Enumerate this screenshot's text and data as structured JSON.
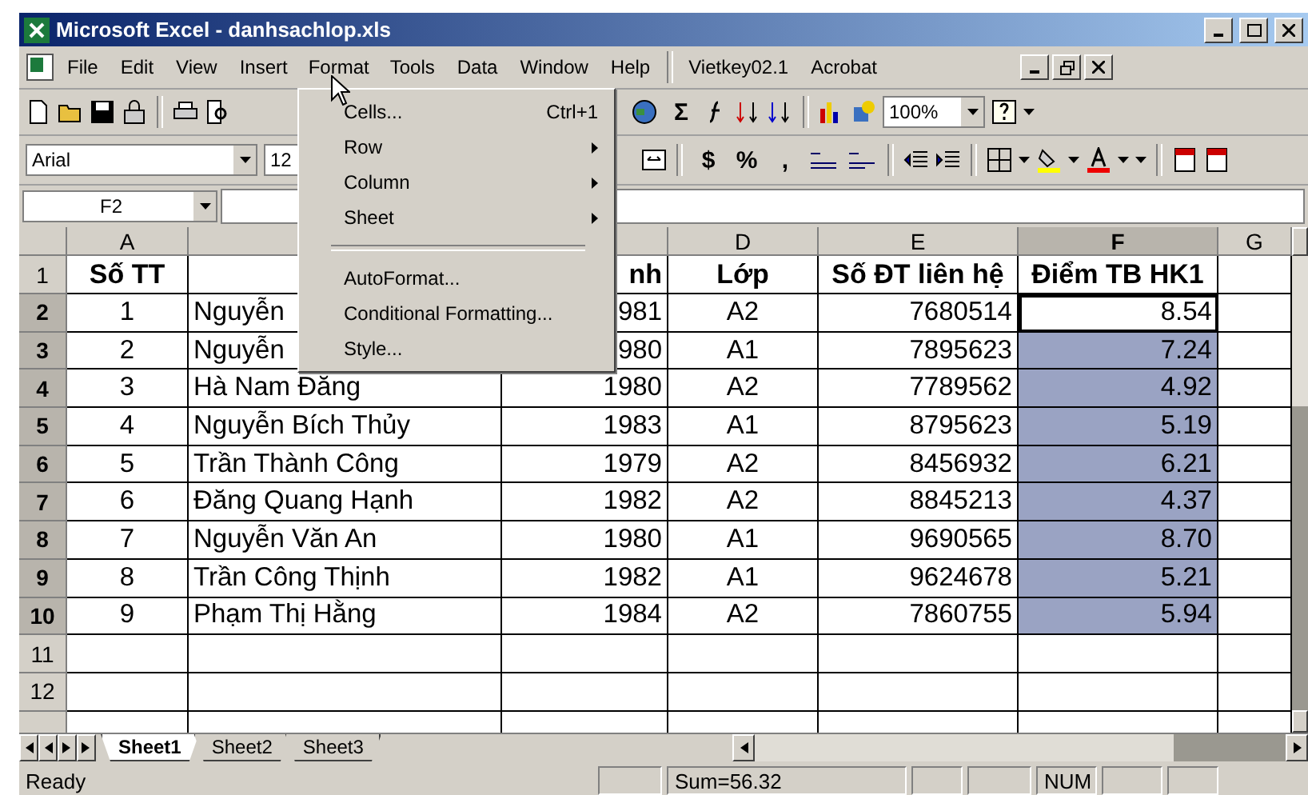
{
  "window": {
    "title": "Microsoft Excel - danhsachlop.xls"
  },
  "menu": [
    {
      "label": "File",
      "selected": false
    },
    {
      "label": "Edit",
      "selected": false
    },
    {
      "label": "View",
      "selected": false
    },
    {
      "label": "Insert",
      "selected": false
    },
    {
      "label": "Format",
      "selected": true
    },
    {
      "label": "Tools",
      "selected": false
    },
    {
      "label": "Data",
      "selected": false
    },
    {
      "label": "Window",
      "selected": false
    },
    {
      "label": "Help",
      "selected": false
    },
    {
      "label": "Vietkey02.1",
      "selected": false
    },
    {
      "label": "Acrobat",
      "selected": false
    }
  ],
  "toolbar": {
    "sum": "Σ",
    "zoom": "100%",
    "font": "Arial",
    "font_size": "12",
    "currency": "$",
    "percent": "%",
    "comma": ","
  },
  "format_menu": [
    {
      "kind": "item",
      "label": "Cells...",
      "shortcut": "Ctrl+1"
    },
    {
      "kind": "submenu",
      "label": "Row"
    },
    {
      "kind": "submenu",
      "label": "Column"
    },
    {
      "kind": "submenu",
      "label": "Sheet"
    },
    {
      "kind": "separator"
    },
    {
      "kind": "item",
      "label": "AutoFormat..."
    },
    {
      "kind": "item",
      "label": "Conditional Formatting..."
    },
    {
      "kind": "item",
      "label": "Style..."
    }
  ],
  "name_box": "F2",
  "columns": [
    {
      "label": "A",
      "selected": false
    },
    {
      "selected": false
    },
    {
      "selected": false
    },
    {
      "label": "D",
      "selected": false
    },
    {
      "label": "E",
      "selected": false
    },
    {
      "label": "F",
      "selected": true
    },
    {
      "label": "G",
      "selected": false
    }
  ],
  "rows": [
    {
      "number": "1",
      "selected": false,
      "cells": [
        "Số TT",
        "",
        "nh",
        "Lớp",
        "Số ĐT liên hệ",
        "Điểm TB HK1"
      ],
      "header": true,
      "score_selected": false,
      "score_active": false
    },
    {
      "number": "2",
      "selected": true,
      "cells": [
        "1",
        "Nguyễn",
        "981",
        "A2",
        "7680514",
        "8.54"
      ],
      "header": false,
      "score_selected": true,
      "score_active": true
    },
    {
      "number": "3",
      "selected": true,
      "cells": [
        "2",
        "Nguyễn",
        "980",
        "A1",
        "7895623",
        "7.24"
      ],
      "header": false,
      "score_selected": true,
      "score_active": false
    },
    {
      "number": "4",
      "selected": true,
      "cells": [
        "3",
        "Hà Nam Đăng",
        "1980",
        "A2",
        "7789562",
        "4.92"
      ],
      "header": false,
      "score_selected": true,
      "score_active": false
    },
    {
      "number": "5",
      "selected": true,
      "cells": [
        "4",
        "Nguyễn Bích Thủy",
        "1983",
        "A1",
        "8795623",
        "5.19"
      ],
      "header": false,
      "score_selected": true,
      "score_active": false
    },
    {
      "number": "6",
      "selected": true,
      "cells": [
        "5",
        "Trần Thành Công",
        "1979",
        "A2",
        "8456932",
        "6.21"
      ],
      "header": false,
      "score_selected": true,
      "score_active": false
    },
    {
      "number": "7",
      "selected": true,
      "cells": [
        "6",
        "Đăng Quang Hạnh",
        "1982",
        "A2",
        "8845213",
        "4.37"
      ],
      "header": false,
      "score_selected": true,
      "score_active": false
    },
    {
      "number": "8",
      "selected": true,
      "cells": [
        "7",
        "Nguyễn Văn An",
        "1980",
        "A1",
        "9690565",
        "8.70"
      ],
      "header": false,
      "score_selected": true,
      "score_active": false
    },
    {
      "number": "9",
      "selected": true,
      "cells": [
        "8",
        "Trần Công Thịnh",
        "1982",
        "A1",
        "9624678",
        "5.21"
      ],
      "header": false,
      "score_selected": true,
      "score_active": false
    },
    {
      "number": "10",
      "selected": true,
      "cells": [
        "9",
        "Phạm Thị Hằng",
        "1984",
        "A2",
        "7860755",
        "5.94"
      ],
      "header": false,
      "score_selected": true,
      "score_active": false
    },
    {
      "number": "11",
      "selected": false,
      "cells": [
        "",
        "",
        "",
        "",
        "",
        ""
      ],
      "score_selected": false,
      "score_active": false
    },
    {
      "number": "12",
      "selected": false,
      "cells": [
        "",
        "",
        "",
        "",
        "",
        ""
      ],
      "score_selected": false,
      "score_active": false
    }
  ],
  "sheets": [
    {
      "label": "Sheet1",
      "selected": true
    },
    {
      "label": "Sheet2",
      "selected": false
    },
    {
      "label": "Sheet3",
      "selected": false
    }
  ],
  "status_bar": {
    "left": "Ready",
    "sum": "Sum=56.32",
    "mode": "NUM"
  }
}
